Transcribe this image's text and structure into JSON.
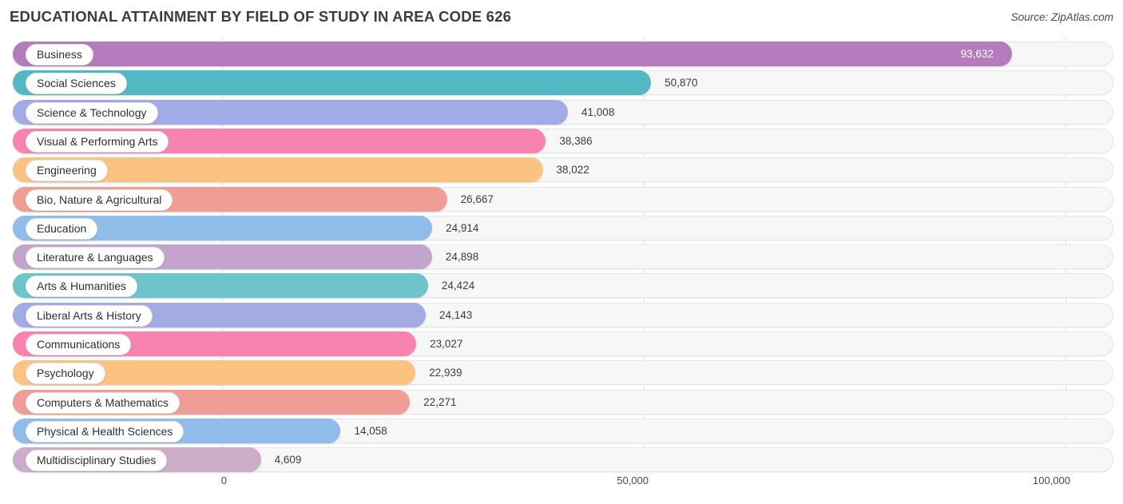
{
  "header": {
    "title": "EDUCATIONAL ATTAINMENT BY FIELD OF STUDY IN AREA CODE 626",
    "source": "Source: ZipAtlas.com"
  },
  "chart_data": {
    "type": "bar",
    "orientation": "horizontal",
    "title": "EDUCATIONAL ATTAINMENT BY FIELD OF STUDY IN AREA CODE 626",
    "xlabel": "",
    "ylabel": "",
    "xlim": [
      0,
      110000
    ],
    "grid": true,
    "legend": "none",
    "tick_labels": [
      "0",
      "50,000",
      "100,000"
    ],
    "tick_values": [
      0,
      50000,
      100000
    ],
    "categories": [
      "Business",
      "Social Sciences",
      "Science & Technology",
      "Visual & Performing Arts",
      "Engineering",
      "Bio, Nature & Agricultural",
      "Education",
      "Literature & Languages",
      "Arts & Humanities",
      "Liberal Arts & History",
      "Communications",
      "Psychology",
      "Computers & Mathematics",
      "Physical & Health Sciences",
      "Multidisciplinary Studies"
    ],
    "values": [
      93632,
      50870,
      41008,
      38386,
      38022,
      26667,
      24914,
      24898,
      24424,
      24143,
      23027,
      22939,
      22271,
      14058,
      4609
    ],
    "value_labels": [
      "93,632",
      "50,870",
      "41,008",
      "38,386",
      "38,022",
      "26,667",
      "24,914",
      "24,898",
      "24,424",
      "24,143",
      "23,027",
      "22,939",
      "22,271",
      "14,058",
      "4,609"
    ],
    "colors": [
      "#b47bbd",
      "#53b8c4",
      "#a3abe4",
      "#f783ae",
      "#fbc382",
      "#ef9e96",
      "#8fbce8",
      "#c3a4cd",
      "#6ec4ca",
      "#a3abe4",
      "#f783ae",
      "#fbc382",
      "#ef9e96",
      "#8fbce8",
      "#cbadc9"
    ],
    "label_inside": [
      true,
      false,
      false,
      false,
      false,
      false,
      false,
      false,
      false,
      false,
      false,
      false,
      false,
      false,
      false
    ]
  },
  "colors": {
    "track": "#f7f7f7",
    "track_border": "#e6e6e6",
    "grid": "#e2e2e6",
    "text": "#3c3c3c"
  }
}
